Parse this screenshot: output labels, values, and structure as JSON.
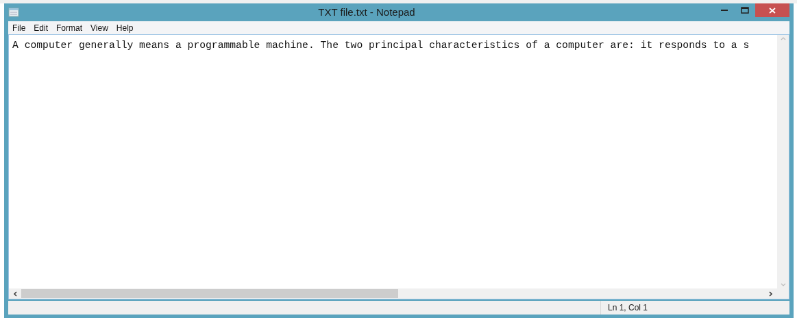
{
  "window": {
    "title": "TXT file.txt - Notepad"
  },
  "menu": [
    "File",
    "Edit",
    "Format",
    "View",
    "Help"
  ],
  "document": {
    "text": "A computer generally means a programmable machine. The two principal characteristics of a computer are: it responds to a s"
  },
  "status_bar": {
    "position": "Ln 1, Col 1"
  }
}
